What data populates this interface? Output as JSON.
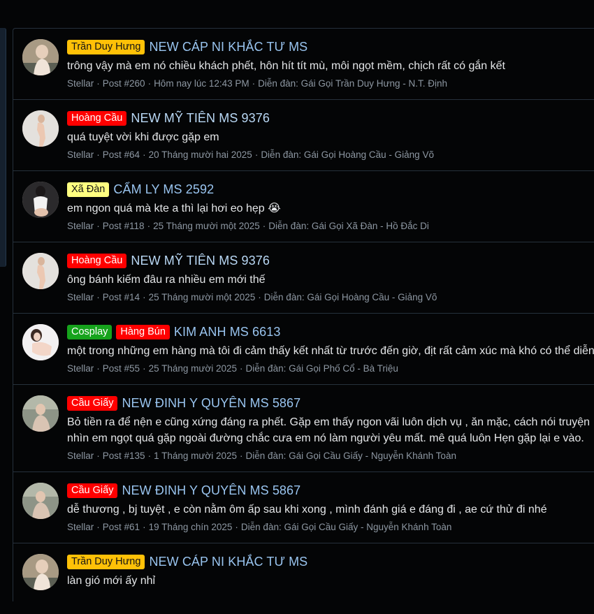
{
  "colors": {
    "prefix_yellow": "#ffc107",
    "prefix_red": "#ff0000",
    "prefix_green": "#16a31c",
    "prefix_lightyellow": "#ffff80",
    "link": "#99c4ef"
  },
  "posts": [
    {
      "prefixes": [
        {
          "label": "Trần Duy Hưng",
          "style": "yellow"
        }
      ],
      "title": "NEW CÁP NI KHẮC TƯ MS",
      "lines": [
        "trông vậy mà em nó chiều khách phết, hôn hít tít mù, môi ngọt mềm, chịch rất có gắn kết"
      ],
      "author": "Stellar",
      "post_no": "Post #260",
      "date": "Hôm nay lúc 12:43 PM",
      "forum": "Diễn đàn: Gái Gọi Trần Duy Hưng - N.T. Định"
    },
    {
      "prefixes": [
        {
          "label": "Hoàng Cầu",
          "style": "red"
        }
      ],
      "title": "NEW MỸ TIÊN MS 9376",
      "lines": [
        "quá tuyệt vời khi được gặp em"
      ],
      "author": "Stellar",
      "post_no": "Post #64",
      "date": "20 Tháng mười hai 2025",
      "forum": "Diễn đàn: Gái Gọi Hoàng Cầu - Giảng Võ"
    },
    {
      "prefixes": [
        {
          "label": "Xã Đàn",
          "style": "lightyellow"
        }
      ],
      "title": "CẨM LY MS 2592",
      "lines": [
        "em ngon quá mà kte a thì lại hơi eo hẹp 😭"
      ],
      "author": "Stellar",
      "post_no": "Post #118",
      "date": "25 Tháng mười một 2025",
      "forum": "Diễn đàn: Gái Gọi Xã Đàn - Hồ Đắc Di"
    },
    {
      "prefixes": [
        {
          "label": "Hoàng Cầu",
          "style": "red"
        }
      ],
      "title": "NEW MỸ TIÊN MS 9376",
      "lines": [
        "ông bánh kiếm đâu ra nhiều em mới thế"
      ],
      "author": "Stellar",
      "post_no": "Post #14",
      "date": "25 Tháng mười một 2025",
      "forum": "Diễn đàn: Gái Gọi Hoàng Cầu - Giảng Võ"
    },
    {
      "prefixes": [
        {
          "label": "Cosplay",
          "style": "green"
        },
        {
          "label": "Hàng Bún",
          "style": "red"
        }
      ],
      "title": "KIM ANH MS 6613",
      "lines": [
        "một trong những em hàng mà tôi đi cảm thấy kết nhất từ trước đến giờ, địt rất cảm xúc mà khó có thể diễn tả"
      ],
      "author": "Stellar",
      "post_no": "Post #55",
      "date": "25 Tháng mười 2025",
      "forum": "Diễn đàn: Gái Gọi Phố Cổ - Bà Triệu"
    },
    {
      "prefixes": [
        {
          "label": "Cầu Giấy",
          "style": "red"
        }
      ],
      "title": "NEW ĐINH Y QUYÊN MS 5867",
      "lines": [
        "Bỏ tiền ra để nện e cũng xứng đáng ra phết. Gặp em thấy ngon vãi luôn dịch vụ , ăn mặc, cách nói truyện",
        "nhìn em ngọt quá gặp ngoài đường chắc cưa em nó làm người yêu mất. mê quá luôn Hẹn gặp lại e vào."
      ],
      "author": "Stellar",
      "post_no": "Post #135",
      "date": "1 Tháng mười 2025",
      "forum": "Diễn đàn: Gái Gọi Cầu Giấy - Nguyễn Khánh Toàn"
    },
    {
      "prefixes": [
        {
          "label": "Cầu Giấy",
          "style": "red"
        }
      ],
      "title": "NEW ĐINH Y QUYÊN MS 5867",
      "lines": [
        "dễ thương , bj tuyệt , e còn nằm ôm ấp sau khi xong , mình đánh giá e đáng đi , ae cứ thử đi nhé"
      ],
      "author": "Stellar",
      "post_no": "Post #61",
      "date": "19 Tháng chín 2025",
      "forum": "Diễn đàn: Gái Gọi Cầu Giấy - Nguyễn Khánh Toàn"
    },
    {
      "prefixes": [
        {
          "label": "Trần Duy Hưng",
          "style": "yellow"
        }
      ],
      "title": "NEW CÁP NI KHẮC TƯ MS",
      "lines": [
        "làn gió mới ấy nhỉ"
      ],
      "author": "",
      "post_no": "",
      "date": "",
      "forum": ""
    }
  ]
}
